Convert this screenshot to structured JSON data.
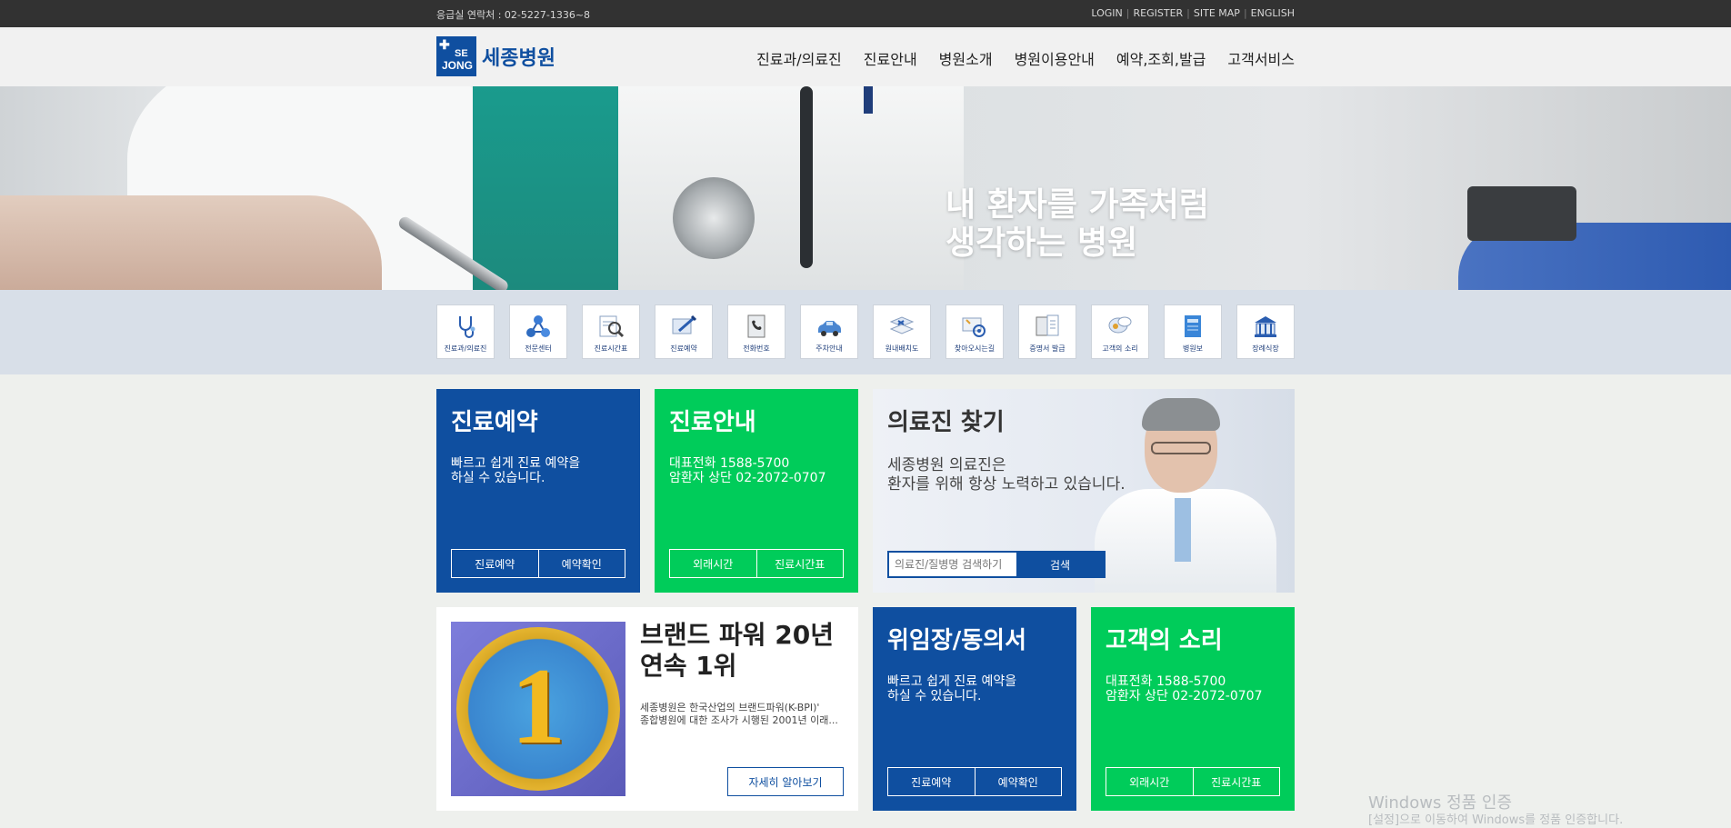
{
  "topbar": {
    "emergency": "응급실 연락처 : 02-5227-1336~8",
    "links": [
      "LOGIN",
      "REGISTER",
      "SITE MAP",
      "ENGLISH"
    ]
  },
  "logo": {
    "mark_line1": "SE",
    "mark_line2": "JONG",
    "text": "세종병원"
  },
  "nav": [
    "진료과/의료진",
    "진료안내",
    "병원소개",
    "병원이용안내",
    "예약,조회,발급",
    "고객서비스"
  ],
  "hero": {
    "line1": "내 환자를 가족처럼",
    "line2": "생각하는 병원"
  },
  "quick_links": [
    {
      "label": "진료과/의료진",
      "icon": "stethoscope-icon"
    },
    {
      "label": "전문센터",
      "icon": "molecule-icon"
    },
    {
      "label": "진료시간표",
      "icon": "schedule-search-icon"
    },
    {
      "label": "진료예약",
      "icon": "reservation-icon"
    },
    {
      "label": "전화번호",
      "icon": "phone-book-icon"
    },
    {
      "label": "주차안내",
      "icon": "car-icon"
    },
    {
      "label": "원내배치도",
      "icon": "floor-map-icon"
    },
    {
      "label": "찾아오시는길",
      "icon": "location-map-icon"
    },
    {
      "label": "증명서 발급",
      "icon": "certificate-icon"
    },
    {
      "label": "고객의 소리",
      "icon": "speech-bubble-icon"
    },
    {
      "label": "병원보",
      "icon": "newsletter-icon"
    },
    {
      "label": "장례식장",
      "icon": "funeral-hall-icon"
    }
  ],
  "cards": {
    "reservation": {
      "title": "진료예약",
      "line1": "빠르고 쉽게 진료 예약을",
      "line2": "하실 수 있습니다.",
      "btn1": "진료예약",
      "btn2": "예약확인"
    },
    "info": {
      "title": "진료안내",
      "line1": "대표전화 1588-5700",
      "line2": "암환자 상단 02-2072-0707",
      "btn1": "외래시간",
      "btn2": "진료시간표"
    },
    "doctor": {
      "title": "의료진 찾기",
      "line1": "세종병원 의료진은",
      "line2": "환자를 위해 항상 노력하고 있습니다.",
      "search_placeholder": "의료진/질병명 검색하기",
      "search_button": "검색"
    },
    "brand": {
      "title_line1": "브랜드 파워 20년",
      "title_line2": "연속 1위",
      "desc_line1": "세종병원은 한국산업의 브랜드파워(K-BPI)'",
      "desc_line2": "종합병원에 대한 조사가 시행된 2001년 이래...",
      "badge_digit": "1",
      "more": "자세히 알아보기"
    },
    "consent": {
      "title": "위임장/동의서",
      "line1": "빠르고 쉽게 진료 예약을",
      "line2": "하실 수 있습니다.",
      "btn1": "진료예약",
      "btn2": "예약확인"
    },
    "voice": {
      "title": "고객의 소리",
      "line1": "대표전화 1588-5700",
      "line2": "암환자 상단 02-2072-0707",
      "btn1": "외래시간",
      "btn2": "진료시간표"
    }
  },
  "watermark": {
    "line1": "Windows 정품 인증",
    "line2": "[설정]으로 이동하여 Windows를 정품 인증합니다."
  },
  "colors": {
    "brand_blue": "#0f4fa0",
    "brand_green": "#00cc5a",
    "topbar": "#323232"
  }
}
